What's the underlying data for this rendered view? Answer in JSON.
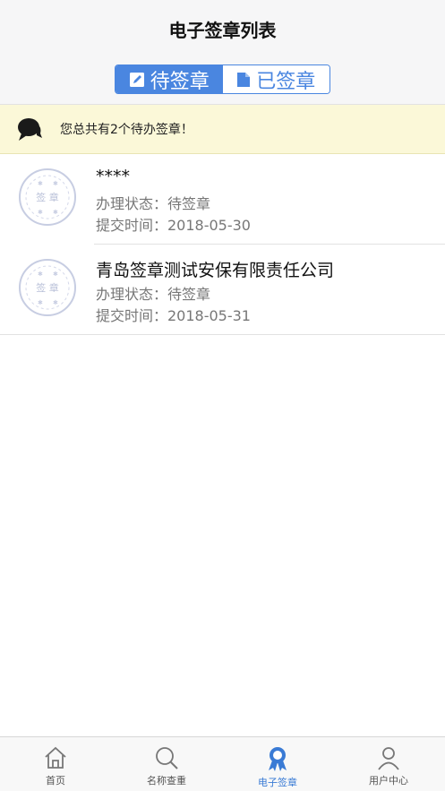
{
  "header": {
    "title": "电子签章列表"
  },
  "segment": {
    "pending_label": "待签章",
    "signed_label": "已签章"
  },
  "notice": {
    "text": "您总共有2个待办签章！"
  },
  "items": [
    {
      "title": "****",
      "status": "办理状态：待签章",
      "date": "提交时间：2018-05-30",
      "seal_text": "签 章"
    },
    {
      "title": "青岛签章测试安保有限责任公司",
      "status": "办理状态：待签章",
      "date": "提交时间：2018-05-31",
      "seal_text": "签 章"
    }
  ],
  "tabbar": {
    "tabs": [
      {
        "label": "首页",
        "icon": "home-icon"
      },
      {
        "label": "名称查重",
        "icon": "search-icon"
      },
      {
        "label": "电子签章",
        "icon": "ribbon-badge-icon"
      },
      {
        "label": "用户中心",
        "icon": "user-icon"
      }
    ],
    "active_color": "#3a7bd5"
  },
  "colors": {
    "accent": "#4a86e0",
    "notice_bg": "#fbf8d8"
  }
}
